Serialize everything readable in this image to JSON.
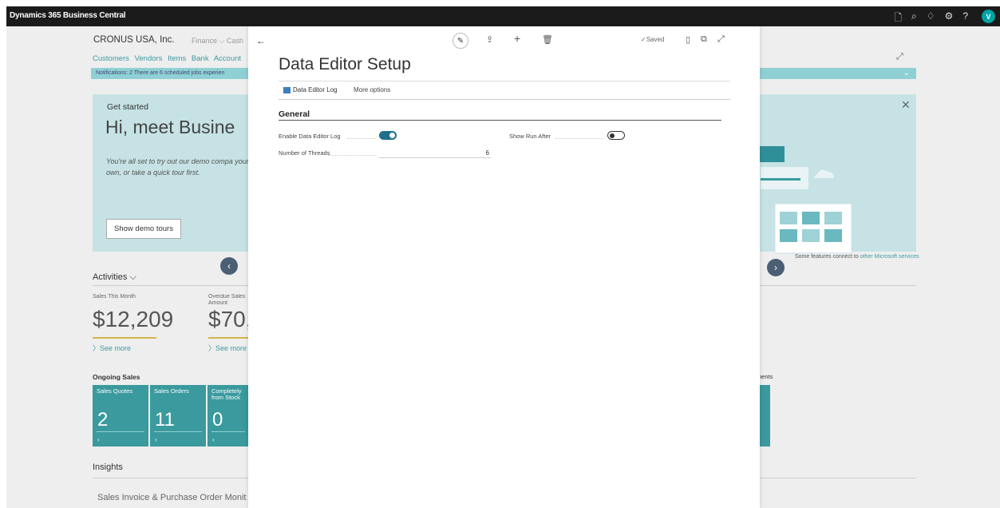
{
  "topbar": {
    "app_title": "Dynamics 365 Business Central",
    "avatar_initial": "V"
  },
  "background": {
    "company": "CRONUS USA, Inc.",
    "menu": "Finance ⌵   Cash",
    "links": "Customers  Vendors  Items  Bank Account",
    "notification": "Notifications: 2   There are 6 scheduled jobs experien",
    "hero": {
      "get_started": "Get started",
      "heading": "Hi, meet Busine",
      "text": "You're all set to try out our demo compa your own, or take a quick tour first.",
      "demo_button": "Show demo tours"
    },
    "features_prefix": "Some features connect to ",
    "features_link": "other Microsoft services",
    "activities": "Activities ⌵",
    "kpis": [
      {
        "label": "Sales This Month",
        "value": "$12,209",
        "see_more": "〉See more"
      },
      {
        "label": "Overdue Sales Amount",
        "value": "$70,",
        "see_more": "〉See more"
      }
    ],
    "ongoing_sales": "Ongoing Sales",
    "tiles": [
      {
        "label": "Sales Quotes",
        "value": "2"
      },
      {
        "label": "Sales Orders",
        "value": "11"
      },
      {
        "label": "Completely from Stock",
        "value": "0"
      }
    ],
    "ments": "nents",
    "insights": "Insights",
    "insights_sub": "Sales Invoice & Purchase Order Monit"
  },
  "dialog": {
    "title": "Data Editor Setup",
    "saved": "✓Saved",
    "actions": {
      "log": "Data Editor Log",
      "more": "More options"
    },
    "section": "General",
    "fields": {
      "enable_log_label": "Enable Data Editor Log",
      "enable_log_value": true,
      "show_run_after_label": "Show Run After",
      "show_run_after_value": false,
      "threads_label": "Number of Threads",
      "threads_value": "6"
    }
  },
  "icons": [
    "back-arrow-icon",
    "edit-icon",
    "share-icon",
    "add-icon",
    "delete-icon",
    "bookmark-icon",
    "open-new-window-icon",
    "expand-icon",
    "search-icon",
    "bell-icon",
    "gear-icon",
    "help-icon"
  ],
  "colors": {
    "teal": "#3a9a9e",
    "toggle_on": "#1f6f8b",
    "topbar": "#1b1b1b"
  }
}
